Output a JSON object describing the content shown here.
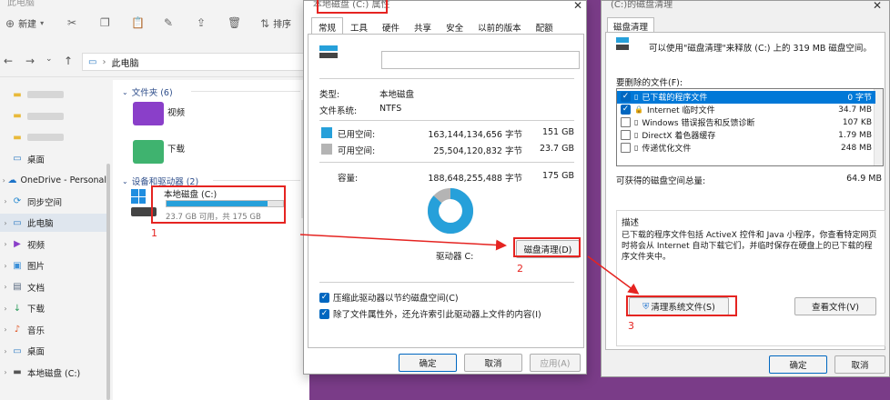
{
  "explorer": {
    "title": "此电脑",
    "toolbar": {
      "new": "新建",
      "sort": "排序"
    },
    "address": "此电脑",
    "sidebar": [
      {
        "label": "",
        "icon": "folder-icon",
        "blurred": true
      },
      {
        "label": "",
        "icon": "folder-icon",
        "blurred": true
      },
      {
        "label": "",
        "icon": "folder-icon",
        "blurred": true
      },
      {
        "label": "桌面",
        "icon": "desktop-icon"
      },
      {
        "label": "OneDrive - Personal",
        "icon": "cloud-icon"
      },
      {
        "label": "同步空间",
        "icon": "sync-icon"
      },
      {
        "label": "此电脑",
        "icon": "pc-icon",
        "active": true
      },
      {
        "label": "视频",
        "icon": "video-icon"
      },
      {
        "label": "图片",
        "icon": "image-icon"
      },
      {
        "label": "文档",
        "icon": "doc-icon"
      },
      {
        "label": "下载",
        "icon": "download-icon"
      },
      {
        "label": "音乐",
        "icon": "music-icon"
      },
      {
        "label": "桌面",
        "icon": "desktop-icon"
      },
      {
        "label": "本地磁盘 (C:)",
        "icon": "drive-icon"
      }
    ],
    "folders_header": "文件夹 (6)",
    "folders": [
      {
        "label": "视频"
      },
      {
        "label": "下载"
      }
    ],
    "devices_header": "设备和驱动器 (2)",
    "drive": {
      "label": "本地磁盘 (C:)",
      "sub": "23.7 GB 可用，共 175 GB",
      "used_fraction": 0.865
    }
  },
  "props": {
    "title": "本地磁盘 (C:) 属性",
    "tabs": [
      "常规",
      "工具",
      "硬件",
      "共享",
      "安全",
      "以前的版本",
      "配额"
    ],
    "type_label": "类型:",
    "type_value": "本地磁盘",
    "fs_label": "文件系统:",
    "fs_value": "NTFS",
    "used_label": "已用空间:",
    "used_bytes": "163,144,134,656 字节",
    "used_gb": "151 GB",
    "free_label": "可用空间:",
    "free_bytes": "25,504,120,832 字节",
    "free_gb": "23.7 GB",
    "cap_label": "容量:",
    "cap_bytes": "188,648,255,488 字节",
    "cap_gb": "175 GB",
    "drive_label": "驱动器 C:",
    "cleanup_btn": "磁盘清理(D)",
    "compress_chk": "压缩此驱动器以节约磁盘空间(C)",
    "index_chk": "除了文件属性外，还允许索引此驱动器上文件的内容(I)",
    "ok": "确定",
    "cancel": "取消",
    "apply": "应用(A)",
    "colors": {
      "used": "#26a0da",
      "free": "#b4b4b4"
    },
    "used_fraction": 0.865
  },
  "cleanup": {
    "title": "(C:)的磁盘清理",
    "tab": "磁盘清理",
    "info": "可以使用\"磁盘清理\"来释放 (C:) 上的 319 MB 磁盘空间。",
    "list_label": "要删除的文件(F):",
    "items": [
      {
        "name": "已下载的程序文件",
        "size": "0 字节",
        "checked": true,
        "selected": true
      },
      {
        "name": "Internet 临时文件",
        "size": "34.7 MB",
        "checked": true
      },
      {
        "name": "Windows 错误报告和反馈诊断",
        "size": "107 KB",
        "checked": false
      },
      {
        "name": "DirectX 着色器缓存",
        "size": "1.79 MB",
        "checked": false
      },
      {
        "name": "传递优化文件",
        "size": "248 MB",
        "checked": false
      }
    ],
    "total_label": "可获得的磁盘空间总量:",
    "total_value": "64.9 MB",
    "desc_label": "描述",
    "desc": "已下载的程序文件包括 ActiveX 控件和 Java 小程序，你查看特定网页时将会从 Internet 自动下载它们，并临时保存在硬盘上的已下载的程序文件夹中。",
    "sys_btn": "清理系统文件(S)",
    "view_btn": "查看文件(V)",
    "ok": "确定",
    "cancel": "取消"
  },
  "annotations": [
    "1",
    "2",
    "3"
  ]
}
